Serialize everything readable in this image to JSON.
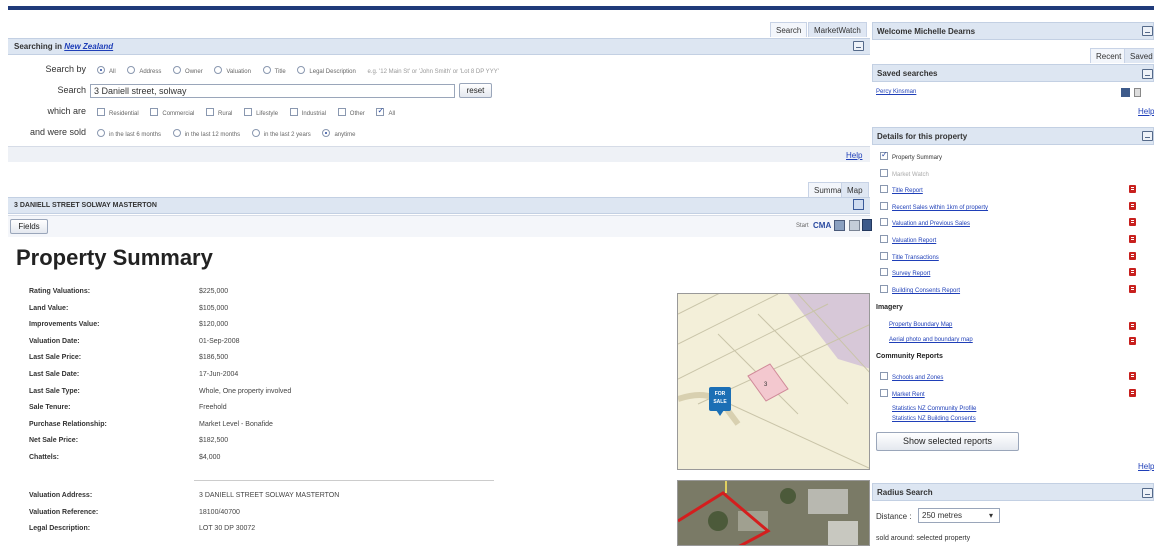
{
  "top_tabs": [
    "Search",
    "MarketWatch"
  ],
  "search_header": {
    "prefix": "Searching in",
    "region": "New Zealand"
  },
  "search_form": {
    "search_by_label": "Search by",
    "search_by_options": [
      "All",
      "Address",
      "Owner",
      "Valuation",
      "Title",
      "Legal Description"
    ],
    "search_by_selected": "All",
    "example_hint": "e.g. '12 Main St' or 'John Smith' or 'Lot 8 DP YYY'",
    "search_label": "Search",
    "search_value": "3 Daniell street, solway",
    "reset_label": "reset",
    "which_are_label": "which are",
    "type_options": [
      "Residential",
      "Commercial",
      "Rural",
      "Lifestyle",
      "Industrial",
      "Other",
      "All"
    ],
    "type_checked": "All",
    "sold_label": "and were sold",
    "sold_options": [
      "in the last 6 months",
      "in the last 12 months",
      "in the last 2 years",
      "anytime"
    ],
    "sold_selected": "anytime"
  },
  "help_label": "Help",
  "view_tabs": [
    "Summary",
    "Map"
  ],
  "property_header": "3 DANIELL STREET SOLWAY MASTERTON",
  "fields_button": "Fields",
  "start_label": "Start",
  "cma_label": "CMA",
  "page_title": "Property Summary",
  "summary_rows": [
    {
      "label": "Rating Valuations:",
      "value": "$225,000"
    },
    {
      "label": "Land Value:",
      "value": "$105,000"
    },
    {
      "label": "Improvements Value:",
      "value": "$120,000"
    },
    {
      "label": "Valuation Date:",
      "value": "01-Sep-2008"
    },
    {
      "label": "Last Sale Price:",
      "value": "$186,500"
    },
    {
      "label": "Last Sale Date:",
      "value": "17-Jun-2004"
    },
    {
      "label": "Last Sale Type:",
      "value": "Whole, One property involved"
    },
    {
      "label": "Sale Tenure:",
      "value": "Freehold"
    },
    {
      "label": "Purchase Relationship:",
      "value": "Market Level - Bonafide"
    },
    {
      "label": "Net Sale Price:",
      "value": "$182,500"
    },
    {
      "label": "Chattels:",
      "value": "$4,000"
    }
  ],
  "valuation_rows": [
    {
      "label": "Valuation Address:",
      "value": "3 DANIELL STREET SOLWAY MASTERTON"
    },
    {
      "label": "Valuation Reference:",
      "value": "18100/40700"
    },
    {
      "label": "Legal Description:",
      "value": "LOT 30 DP 30072"
    }
  ],
  "map": {
    "parcel_number": "3",
    "pin_text": "FOR SALE"
  },
  "right": {
    "welcome": "Welcome Michelle Dearns",
    "tabs": [
      "Recent",
      "Saved"
    ],
    "saved_searches_title": "Saved searches",
    "saved_search_item": "Percy Kinsman",
    "details_title": "Details for this property",
    "reports": [
      {
        "label": "Property Summary",
        "checked": true,
        "link": false,
        "pdf": false
      },
      {
        "label": "Market Watch",
        "checked": false,
        "link": false,
        "pdf": false,
        "muted": true
      },
      {
        "label": "Title Report",
        "checked": false,
        "link": true,
        "pdf": true
      },
      {
        "label": "Recent Sales within 1km of property",
        "checked": false,
        "link": true,
        "pdf": true
      },
      {
        "label": "Valuation and Previous Sales",
        "checked": false,
        "link": true,
        "pdf": true
      },
      {
        "label": "Valuation Report",
        "checked": false,
        "link": true,
        "pdf": true
      },
      {
        "label": "Title Transactions",
        "checked": false,
        "link": true,
        "pdf": true
      },
      {
        "label": "Survey Report",
        "checked": false,
        "link": true,
        "pdf": true
      },
      {
        "label": "Building Consents Report",
        "checked": false,
        "link": true,
        "pdf": true
      }
    ],
    "imagery_title": "Imagery",
    "imagery": [
      "Property Boundary Map",
      "Aerial photo and boundary map"
    ],
    "community_title": "Community Reports",
    "community": [
      {
        "label": "Schools and Zones",
        "pdf": true
      },
      {
        "label": "Market Rent",
        "pdf": true
      }
    ],
    "stats_links": [
      "Statistics NZ Community Profile",
      "Statistics NZ Building Consents"
    ],
    "show_button": "Show selected reports",
    "radius_title": "Radius Search",
    "distance_label": "Distance :",
    "distance_value": "250 metres",
    "sold_around": "sold around: selected property"
  }
}
